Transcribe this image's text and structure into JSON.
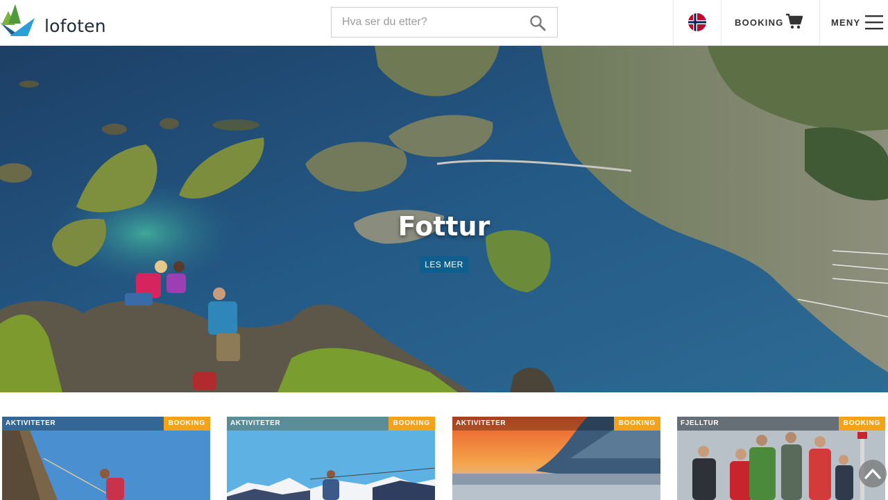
{
  "site": {
    "logo_text": "lofoten"
  },
  "search": {
    "placeholder": "Hva ser du etter?"
  },
  "nav": {
    "language": "norwegian-flag",
    "booking_label": "BOOKING",
    "menu_label": "MENY"
  },
  "hero": {
    "title": "Fottur",
    "button_label": "LES MER"
  },
  "cards": [
    {
      "category": "AKTIVITETER",
      "badge": "BOOKING"
    },
    {
      "category": "AKTIVITETER",
      "badge": "BOOKING"
    },
    {
      "category": "AKTIVITETER",
      "badge": "BOOKING"
    },
    {
      "category": "FJELLTUR",
      "badge": "BOOKING"
    }
  ],
  "icons": {
    "search": "search-icon",
    "cart": "cart-icon",
    "menu": "hamburger-icon",
    "scroll_top": "chevron-up-icon"
  },
  "colors": {
    "accent_blue": "#0d5f8f",
    "booking_orange": "#f5a21b",
    "text_dark": "#1d2b3a"
  }
}
